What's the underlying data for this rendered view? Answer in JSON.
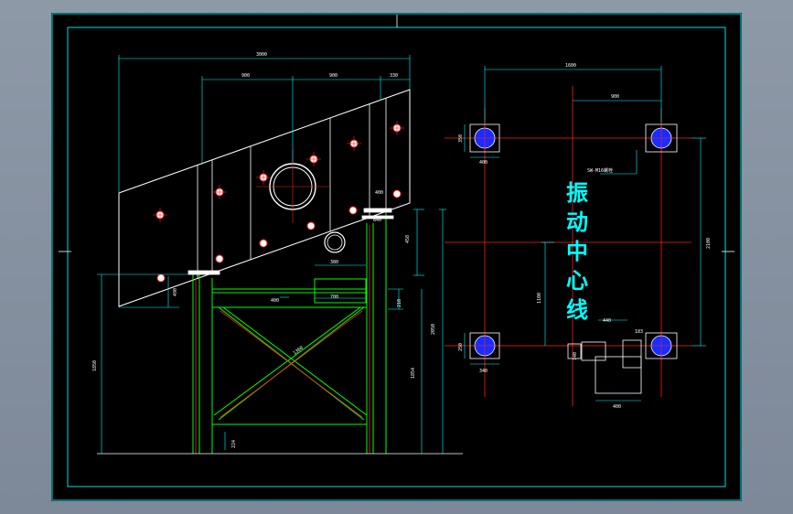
{
  "colors": {
    "background": "#7d8898",
    "sheet": "#000000",
    "outline": "#ffffff",
    "structure": "#00ff00",
    "dimension": "#00ffff",
    "center": "#ff2020",
    "border": "#00e0e0"
  },
  "drawing": {
    "dims": {
      "overall_width": "3000",
      "seg_a": "900",
      "seg_b": "900",
      "seg_c": "330",
      "leg_h": "490",
      "right_h1": "458",
      "right_h2": "2050",
      "right_h3": "1854",
      "left_h": "1850",
      "frame_b": "380",
      "frame_c": "700",
      "frame_d": "840",
      "frame_e": "400",
      "brace": "1360",
      "small_210": "210",
      "base_224": "224",
      "top_400": "400"
    },
    "plan": {
      "width_top": "1600",
      "half_width": "900",
      "height_right": "2100",
      "center_offset": "1100",
      "pad_top_w": "400",
      "pad_top_h": "350",
      "pad_bot_w": "340",
      "pad_bot_h": "250",
      "anchor_note": "SW-M16螺栓",
      "hole_w": "440",
      "hole_h": "183",
      "box_w": "400",
      "box_h": "140",
      "vibration_center_label": [
        "振",
        "动",
        "中",
        "心",
        "线"
      ]
    }
  }
}
